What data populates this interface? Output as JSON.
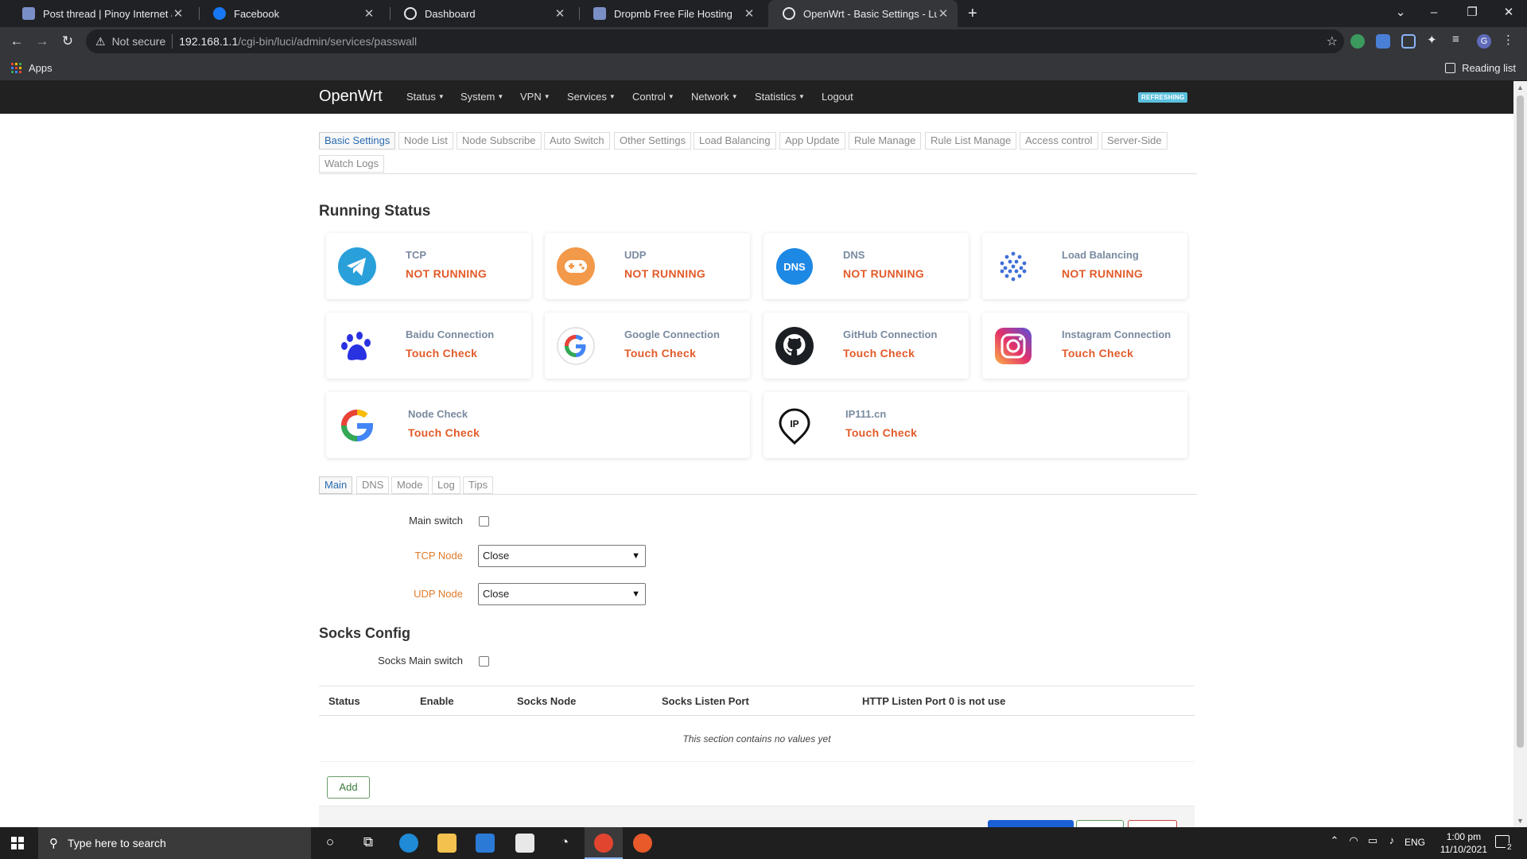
{
  "browser": {
    "tabs": [
      {
        "title": "Post thread | Pinoy Internet and",
        "icon": "shield-favicon"
      },
      {
        "title": "Facebook",
        "icon": "facebook-favicon"
      },
      {
        "title": "Dashboard",
        "icon": "dashboard-favicon"
      },
      {
        "title": "Dropmb Free File Hosting",
        "icon": "shield-favicon"
      },
      {
        "title": "OpenWrt - Basic Settings - LuCI",
        "icon": "globe-favicon"
      }
    ],
    "address": {
      "security": "Not secure",
      "host": "192.168.1.1",
      "path": "/cgi-bin/luci/admin/services/passwall"
    },
    "bookmarks": {
      "apps": "Apps",
      "reading_list": "Reading list"
    }
  },
  "openwrt": {
    "brand": "OpenWrt",
    "menu": [
      "Status",
      "System",
      "VPN",
      "Services",
      "Control",
      "Network",
      "Statistics"
    ],
    "logout": "Logout",
    "refreshing": "REFRESHING"
  },
  "page_tabs": {
    "row1": [
      "Basic Settings",
      "Node List",
      "Node Subscribe",
      "Auto Switch",
      "Other Settings",
      "Load Balancing",
      "App Update",
      "Rule Manage",
      "Rule List Manage",
      "Access control",
      "Server-Side"
    ],
    "row2": [
      "Watch Logs"
    ]
  },
  "running_status": {
    "title": "Running Status",
    "cards": [
      {
        "label": "TCP",
        "value": "NOT RUNNING"
      },
      {
        "label": "UDP",
        "value": "NOT RUNNING"
      },
      {
        "label": "DNS",
        "value": "NOT RUNNING"
      },
      {
        "label": "Load Balancing",
        "value": "NOT RUNNING"
      },
      {
        "label": "Baidu Connection",
        "value": "Touch Check"
      },
      {
        "label": "Google Connection",
        "value": "Touch Check"
      },
      {
        "label": "GitHub Connection",
        "value": "Touch Check"
      },
      {
        "label": "Instagram Connection",
        "value": "Touch Check"
      },
      {
        "label": "Node Check",
        "value": "Touch Check"
      },
      {
        "label": "IP111.cn",
        "value": "Touch Check"
      }
    ],
    "dns_icon_text": "DNS",
    "ip_icon_text": "IP"
  },
  "sub_tabs": [
    "Main",
    "DNS",
    "Mode",
    "Log",
    "Tips"
  ],
  "form": {
    "main_switch": "Main switch",
    "tcp_node": {
      "label": "TCP Node",
      "value": "Close"
    },
    "udp_node": {
      "label": "UDP Node",
      "value": "Close"
    }
  },
  "socks": {
    "title": "Socks Config",
    "main_switch": "Socks Main switch",
    "columns": [
      "Status",
      "Enable",
      "Socks Node",
      "Socks Listen Port",
      "HTTP Listen Port 0 is not use"
    ],
    "empty": "This section contains no values yet",
    "add": "Add"
  },
  "taskbar": {
    "search_placeholder": "Type here to search",
    "lang": "ENG",
    "time": "1:00 pm",
    "date": "11/10/2021",
    "notifications": "2"
  },
  "colors": {
    "accent": "#2a6ab0",
    "status_red": "#e25b2a",
    "label_orange": "#e07b2a",
    "header_bg": "#212121"
  }
}
